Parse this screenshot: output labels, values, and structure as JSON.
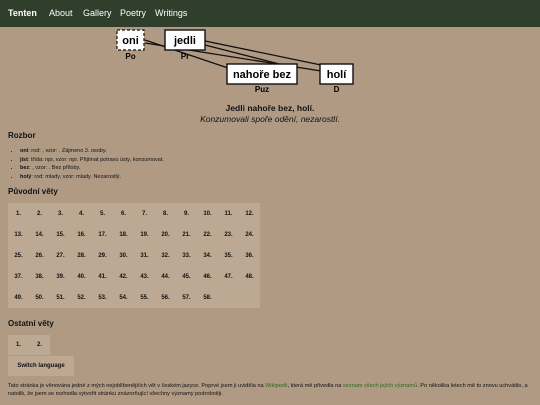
{
  "nav": {
    "brand": "Tenten",
    "links": [
      "About",
      "Gallery",
      "Poetry",
      "Writings"
    ]
  },
  "diagram": {
    "nodes": [
      {
        "label": "oni",
        "role": "Po"
      },
      {
        "label": "jedli",
        "role": "Pr"
      },
      {
        "label": "nahoře bez",
        "role": "Puz"
      },
      {
        "label": "holí",
        "role": "D"
      }
    ]
  },
  "sentence": {
    "text": "Jedli nahoře bez, holí.",
    "translation": "Konzumovali spoře odění, nezarostlí."
  },
  "rozbor": {
    "heading": "Rozbor",
    "items": [
      {
        "word": "oni",
        "desc": ": rod: , vzor: . Zájmeno 3. osoby."
      },
      {
        "word": "jíst",
        "desc": ": třída: npr, vzor: npr. Přijímat potravu ústy, konzumovat."
      },
      {
        "word": "bez",
        "desc": ": , vzor: . Bez příloby."
      },
      {
        "word": "holý",
        "desc": ": rod: mlady, vzor: mlady. Nezarostlý."
      }
    ]
  },
  "puvodni": {
    "heading": "Původní věty",
    "numbers": [
      "1.",
      "2.",
      "3.",
      "4.",
      "5.",
      "6.",
      "7.",
      "8.",
      "9.",
      "10.",
      "11.",
      "12.",
      "13.",
      "14.",
      "15.",
      "16.",
      "17.",
      "18.",
      "19.",
      "20.",
      "21.",
      "22.",
      "23.",
      "24.",
      "25.",
      "26.",
      "27.",
      "28.",
      "29.",
      "30.",
      "31.",
      "32.",
      "33.",
      "34.",
      "35.",
      "36.",
      "37.",
      "38.",
      "39.",
      "40.",
      "41.",
      "42.",
      "43.",
      "44.",
      "45.",
      "46.",
      "47.",
      "48.",
      "49.",
      "50.",
      "51.",
      "52.",
      "53.",
      "54.",
      "55.",
      "56.",
      "57.",
      "58."
    ]
  },
  "ostatni": {
    "heading": "Ostatní věty",
    "numbers": [
      "1.",
      "2."
    ],
    "switch_label": "Switch language"
  },
  "footer": {
    "text1": "Tato stránka je věnována jedné z mých nejoblíbenějších vět v českém jazyce. Poprvé jsem ji uviděla na ",
    "link1": "Wikipedii",
    "text2": ", která mě přivedla na ",
    "link2": "seznam všech jejích významů",
    "text3": ". Po několika letech mě to znovu uchvátilo, a natolik, že jsem se rozhodla vytvořit stránku znázorňující všechny významy podrobněji."
  },
  "colors": {
    "background": "#b09a84",
    "navbar": "#2f3f2c",
    "panel": "#bca893",
    "link": "#2f6a1c"
  }
}
